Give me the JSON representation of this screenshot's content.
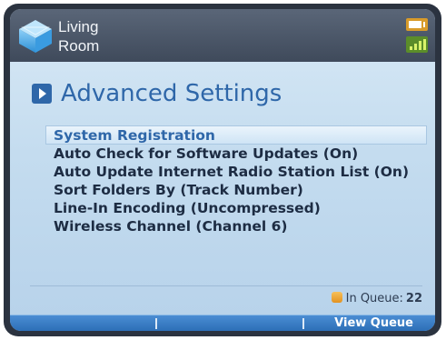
{
  "header": {
    "location_line1": "Living",
    "location_line2": "Room",
    "location_icon": "room-cube-icon",
    "battery_icon": "battery-icon",
    "signal_icon": "signal-strength-icon"
  },
  "page": {
    "title": "Advanced Settings",
    "title_icon": "play-arrow-icon"
  },
  "menu": {
    "items": [
      {
        "label": "System Registration",
        "selected": true
      },
      {
        "label": "Auto Check for Software Updates (On)",
        "selected": false
      },
      {
        "label": "Auto Update Internet Radio Station List (On)",
        "selected": false
      },
      {
        "label": "Sort Folders By (Track Number)",
        "selected": false
      },
      {
        "label": "Line-In Encoding (Uncompressed)",
        "selected": false
      },
      {
        "label": "Wireless Channel (Channel 6)",
        "selected": false
      }
    ]
  },
  "queue": {
    "label": "In Queue:",
    "count": "22",
    "icon": "queue-icon"
  },
  "softkeys": {
    "right_label": "View Queue"
  },
  "colors": {
    "accent": "#2f67a9",
    "header_bg": "#4a5567",
    "softkey_bar": "#3a7dc6",
    "screen_bg": "#c8ddf0"
  }
}
